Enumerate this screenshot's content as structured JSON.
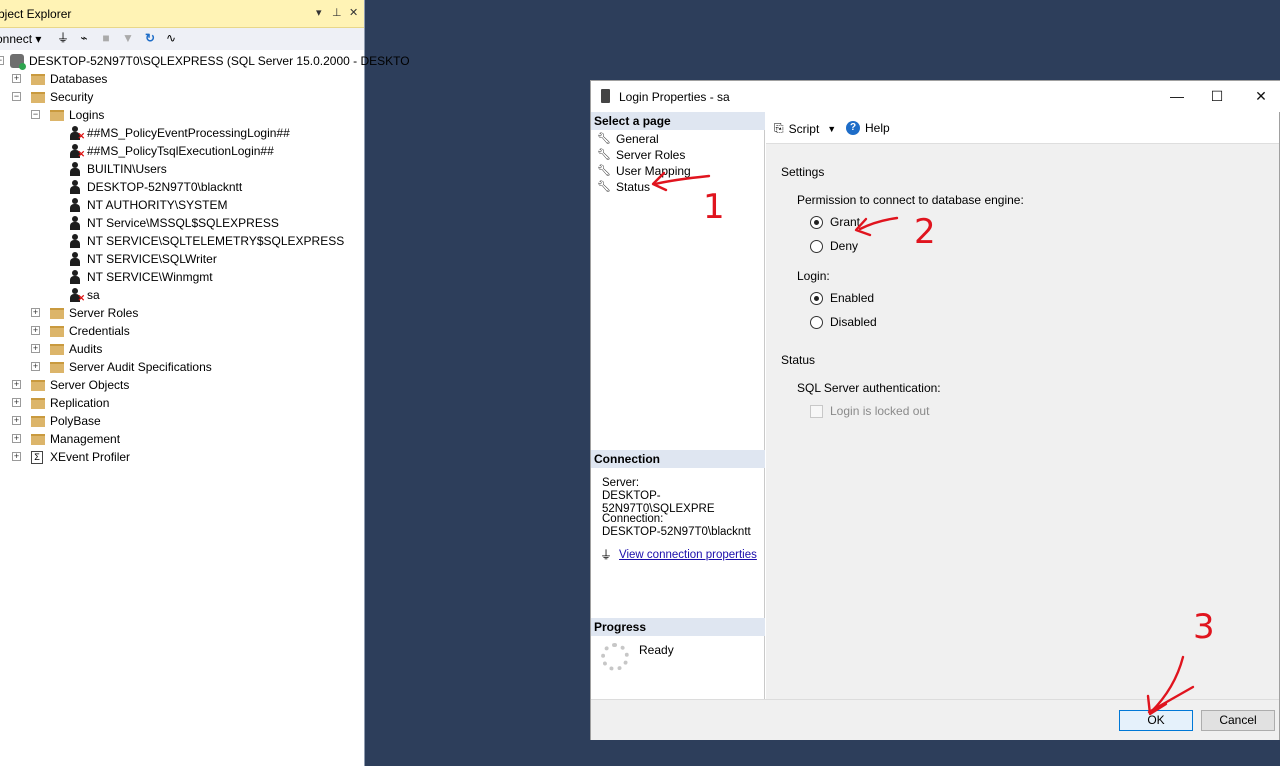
{
  "object_explorer": {
    "title": "bject Explorer",
    "title_controls": [
      "▾",
      "⊥",
      "✕"
    ],
    "connect_label": "onnect",
    "server": "DESKTOP-52N97T0\\SQLEXPRESS (SQL Server 15.0.2000 - DESKTO",
    "tree": {
      "databases": "Databases",
      "security": "Security",
      "logins": "Logins",
      "login_items": [
        {
          "name": "##MS_PolicyEventProcessingLogin##",
          "disabled": true
        },
        {
          "name": "##MS_PolicyTsqlExecutionLogin##",
          "disabled": true
        },
        {
          "name": "BUILTIN\\Users",
          "disabled": false
        },
        {
          "name": "DESKTOP-52N97T0\\blackntt",
          "disabled": false
        },
        {
          "name": "NT AUTHORITY\\SYSTEM",
          "disabled": false
        },
        {
          "name": "NT Service\\MSSQL$SQLEXPRESS",
          "disabled": false
        },
        {
          "name": "NT SERVICE\\SQLTELEMETRY$SQLEXPRESS",
          "disabled": false
        },
        {
          "name": "NT SERVICE\\SQLWriter",
          "disabled": false
        },
        {
          "name": "NT SERVICE\\Winmgmt",
          "disabled": false
        },
        {
          "name": "sa",
          "disabled": true
        }
      ],
      "security_children": [
        "Server Roles",
        "Credentials",
        "Audits",
        "Server Audit Specifications"
      ],
      "server_children": [
        "Server Objects",
        "Replication",
        "PolyBase",
        "Management"
      ],
      "xevent": "XEvent Profiler"
    }
  },
  "dialog": {
    "title": "Login Properties - sa",
    "select_page_header": "Select a page",
    "pages": [
      "General",
      "Server Roles",
      "User Mapping",
      "Status"
    ],
    "connection_header": "Connection",
    "server_label": "Server:",
    "server_value": "DESKTOP-52N97T0\\SQLEXPRE",
    "connection_label": "Connection:",
    "connection_value": "DESKTOP-52N97T0\\blackntt",
    "view_connection_link": "View connection properties",
    "progress_header": "Progress",
    "progress_status": "Ready",
    "toolbar": {
      "script": "Script",
      "help": "Help"
    },
    "settings_label": "Settings",
    "permission_label": "Permission to connect to database engine:",
    "grant_label": "Grant",
    "deny_label": "Deny",
    "permission_selected": "Grant",
    "login_label": "Login:",
    "enabled_label": "Enabled",
    "disabled_label": "Disabled",
    "login_selected": "Enabled",
    "status_label": "Status",
    "sql_auth_label": "SQL Server authentication:",
    "locked_out_label": "Login is locked out",
    "ok_button": "OK",
    "cancel_button": "Cancel"
  },
  "annotations": {
    "step1": "1",
    "step2": "2",
    "step3": "3",
    "color": "#e0141e"
  },
  "colors": {
    "desktop_bg": "#2d3e5b",
    "oe_title_bg": "#fff3b5",
    "section_header_bg": "#dfe6f1",
    "link": "#1a0dab"
  }
}
